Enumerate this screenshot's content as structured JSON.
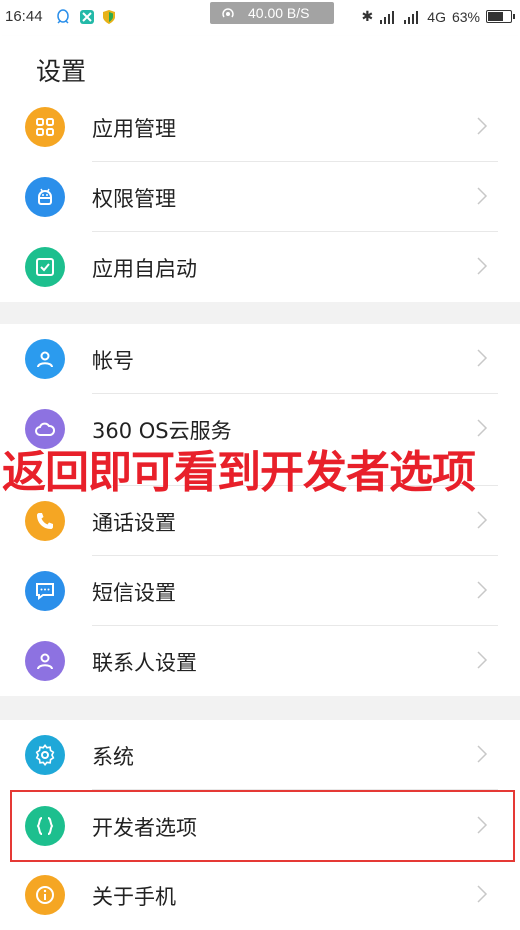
{
  "status_bar": {
    "time": "16:44",
    "net_speed": "40.00 B/S",
    "network": "4G",
    "battery": "63%",
    "battery_level": 0.63,
    "left_icons": [
      "qq-icon",
      "app-icon",
      "shield-icon"
    ]
  },
  "header": {
    "title": "设置"
  },
  "groups": [
    {
      "items": [
        {
          "label": "应用管理",
          "icon": "grid-icon",
          "color": "#F5A623"
        },
        {
          "label": "权限管理",
          "icon": "android-icon",
          "color": "#2B8FEA"
        },
        {
          "label": "应用自启动",
          "icon": "checkbox-icon",
          "color": "#1DBF8E"
        }
      ]
    },
    {
      "items": [
        {
          "label": "帐号",
          "icon": "person-icon",
          "color": "#2B9BEE"
        },
        {
          "label": "360 OS云服务",
          "icon": "cloud-icon",
          "color": "#8D72E1"
        },
        {
          "label": "通话设置",
          "icon": "phone-icon",
          "color": "#F5A623"
        },
        {
          "label": "短信设置",
          "icon": "message-icon",
          "color": "#2B8FEA"
        },
        {
          "label": "联系人设置",
          "icon": "person-icon",
          "color": "#8D72E1"
        }
      ]
    },
    {
      "items": [
        {
          "label": "系统",
          "icon": "gear-icon",
          "color": "#1FA8D8"
        },
        {
          "label": "开发者选项",
          "icon": "braces-icon",
          "color": "#1DBF8E"
        },
        {
          "label": "关于手机",
          "icon": "info-icon",
          "color": "#F5A623"
        }
      ]
    }
  ],
  "overlay_text": "返回即可看到开发者选项",
  "accent_colors": {
    "overlay": "#E8202A",
    "highlight": "#E53935"
  }
}
